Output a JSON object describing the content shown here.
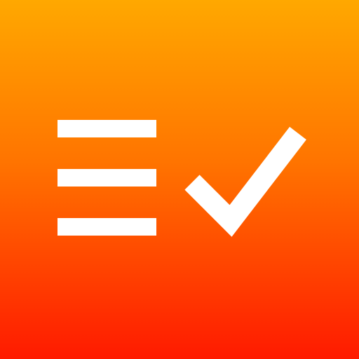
{
  "icon": {
    "name": "checklist-app-icon",
    "glyphs": [
      "list-icon",
      "checkmark-icon"
    ],
    "colors": {
      "gradient_top": "#FFA800",
      "gradient_mid": "#FF7400",
      "gradient_bottom": "#FF1A00",
      "foreground": "#FFFFFF"
    }
  }
}
